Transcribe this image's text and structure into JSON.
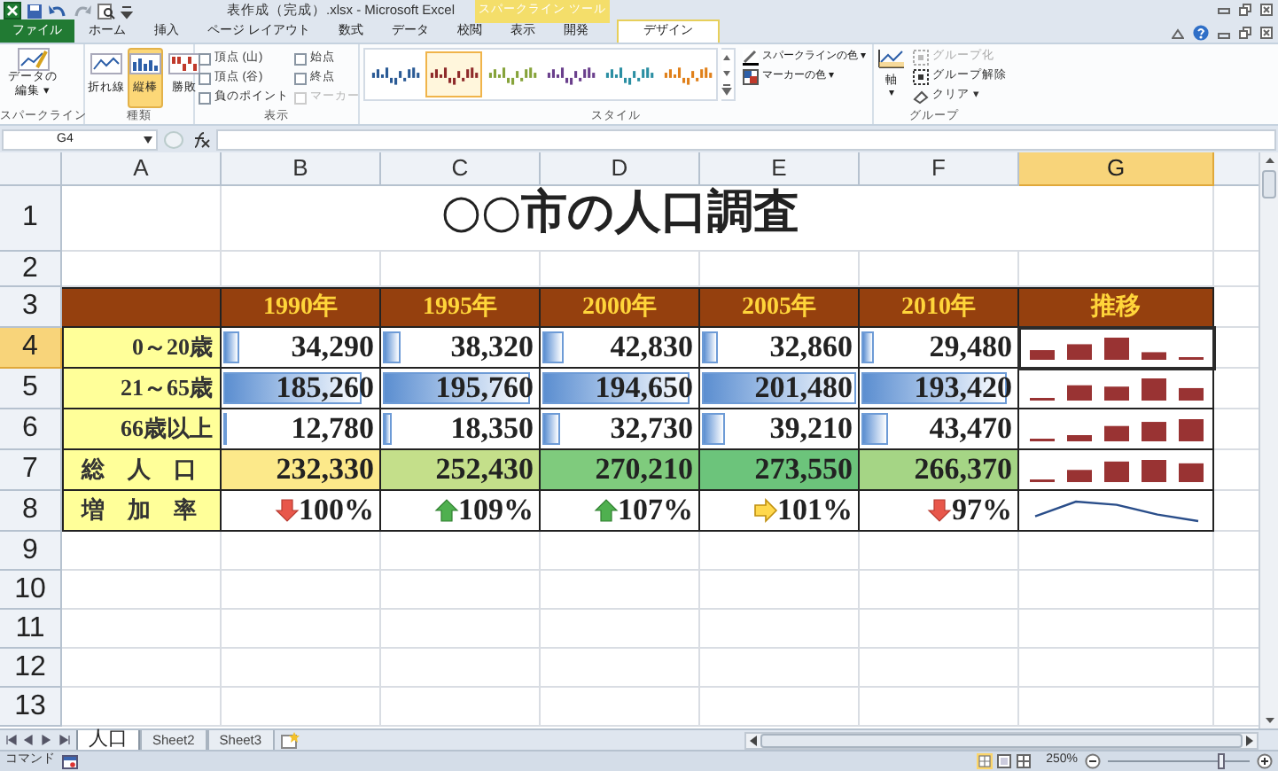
{
  "window": {
    "title": "表作成（完成）.xlsx - Microsoft Excel",
    "context_group": "スパークライン ツール"
  },
  "ribbon_tabs": [
    {
      "label": "ファイル",
      "kind": "file",
      "selected": false
    },
    {
      "label": "ホーム",
      "kind": "tab",
      "selected": false
    },
    {
      "label": "挿入",
      "kind": "tab",
      "selected": false
    },
    {
      "label": "ページ レイアウト",
      "kind": "tab",
      "selected": false
    },
    {
      "label": "数式",
      "kind": "tab",
      "selected": false
    },
    {
      "label": "データ",
      "kind": "tab",
      "selected": false
    },
    {
      "label": "校閲",
      "kind": "tab",
      "selected": false
    },
    {
      "label": "表示",
      "kind": "tab",
      "selected": false
    },
    {
      "label": "開発",
      "kind": "tab",
      "selected": false
    },
    {
      "label": "デザイン",
      "kind": "context",
      "selected": true
    }
  ],
  "ribbon_groups": [
    {
      "label": "スパークライン",
      "kind": "edit",
      "items": [
        {
          "label": "データの編集",
          "caret": "▾",
          "selected": false
        }
      ]
    },
    {
      "label": "種類",
      "kind": "types",
      "items": [
        {
          "label": "折れ線",
          "kind": "line",
          "selected": false
        },
        {
          "label": "縦棒",
          "kind": "column",
          "selected": true
        },
        {
          "label": "勝敗",
          "kind": "winloss",
          "selected": false
        }
      ]
    },
    {
      "label": "表示",
      "kind": "checks",
      "items": [
        {
          "label": "頂点 (山)",
          "checked": false,
          "disabled": false
        },
        {
          "label": "頂点 (谷)",
          "checked": false,
          "disabled": false
        },
        {
          "label": "負のポイント",
          "checked": false,
          "disabled": false
        },
        {
          "label": "始点",
          "checked": false,
          "disabled": false
        },
        {
          "label": "終点",
          "checked": false,
          "disabled": false
        },
        {
          "label": "マーカー",
          "checked": false,
          "disabled": true
        }
      ]
    },
    {
      "label": "スタイル",
      "kind": "styles",
      "items": [
        {
          "color": "#2a5a95",
          "selected": false
        },
        {
          "color": "#8e2a2a",
          "selected": true
        },
        {
          "color": "#86a33a",
          "selected": false
        },
        {
          "color": "#6a3f8c",
          "selected": false
        },
        {
          "color": "#2b8fa3",
          "selected": false
        },
        {
          "color": "#e0801a",
          "selected": false
        }
      ],
      "buttons": [
        {
          "label": "スパークラインの色",
          "caret": "▾"
        },
        {
          "label": "マーカーの色",
          "caret": "▾"
        }
      ]
    },
    {
      "label": "グループ",
      "kind": "group",
      "axis": {
        "label": "軸",
        "caret": "▾"
      },
      "items": [
        {
          "label": "グループ化",
          "disabled": true
        },
        {
          "label": "グループ解除",
          "disabled": false
        },
        {
          "label": "クリア",
          "disabled": false,
          "caret": "▾"
        }
      ]
    }
  ],
  "name_box": "G4",
  "columns": [
    {
      "label": "A",
      "selected": false
    },
    {
      "label": "B",
      "selected": false
    },
    {
      "label": "C",
      "selected": false
    },
    {
      "label": "D",
      "selected": false
    },
    {
      "label": "E",
      "selected": false
    },
    {
      "label": "F",
      "selected": false
    },
    {
      "label": "G",
      "selected": true
    }
  ],
  "row_numbers": [
    {
      "label": "1",
      "selected": false
    },
    {
      "label": "2",
      "selected": false
    },
    {
      "label": "3",
      "selected": false
    },
    {
      "label": "4",
      "selected": true
    },
    {
      "label": "5",
      "selected": false
    },
    {
      "label": "6",
      "selected": false
    },
    {
      "label": "7",
      "selected": false
    },
    {
      "label": "8",
      "selected": false
    },
    {
      "label": "9",
      "selected": false
    },
    {
      "label": "10",
      "selected": false
    },
    {
      "label": "11",
      "selected": false
    },
    {
      "label": "12",
      "selected": false
    },
    {
      "label": "13",
      "selected": false
    }
  ],
  "title": "○○市の人口調査",
  "headers": [
    "1990年",
    "1995年",
    "2000年",
    "2005年",
    "2010年",
    "推移"
  ],
  "data_rows": [
    {
      "label": "0～20歳",
      "kind": "databar",
      "cells": [
        {
          "text": "34,290",
          "level": 0.12
        },
        {
          "text": "38,320",
          "level": 0.14
        },
        {
          "text": "42,830",
          "level": 0.16
        },
        {
          "text": "32,860",
          "level": 0.12
        },
        {
          "text": "29,480",
          "level": 0.1
        }
      ]
    },
    {
      "label": "21～65歳",
      "kind": "databar",
      "cells": [
        {
          "text": "185,260",
          "level": 0.9
        },
        {
          "text": "195,760",
          "level": 0.96
        },
        {
          "text": "194,650",
          "level": 0.96
        },
        {
          "text": "201,480",
          "level": 1.0
        },
        {
          "text": "193,420",
          "level": 0.94
        }
      ]
    },
    {
      "label": "66歳以上",
      "kind": "databar",
      "cells": [
        {
          "text": "12,780",
          "level": 0.05
        },
        {
          "text": "18,350",
          "level": 0.08
        },
        {
          "text": "32,730",
          "level": 0.14
        },
        {
          "text": "39,210",
          "level": 0.17
        },
        {
          "text": "43,470",
          "level": 0.19
        }
      ]
    },
    {
      "label": "総　人　口",
      "kind": "colorscale",
      "cells": [
        {
          "text": "232,330",
          "color": "#fce98a"
        },
        {
          "text": "252,430",
          "color": "#c4df8a"
        },
        {
          "text": "270,210",
          "color": "#7fcb7d"
        },
        {
          "text": "273,550",
          "color": "#6cc47b"
        },
        {
          "text": "266,370",
          "color": "#a5d585"
        }
      ]
    },
    {
      "label": "増　加　率",
      "kind": "iconset",
      "cells": [
        {
          "text": "100%",
          "kind": "down"
        },
        {
          "text": "109%",
          "kind": "up"
        },
        {
          "text": "107%",
          "kind": "up"
        },
        {
          "text": "101%",
          "kind": "right"
        },
        {
          "text": "97%",
          "kind": "down"
        }
      ]
    }
  ],
  "sheets": [
    {
      "label": "人口",
      "selected": true
    },
    {
      "label": "Sheet2",
      "selected": false
    },
    {
      "label": "Sheet3",
      "selected": false
    }
  ],
  "status": {
    "mode": "コマンド",
    "zoom": "250%",
    "zoom_level": {
      "level": 0.8
    }
  }
}
